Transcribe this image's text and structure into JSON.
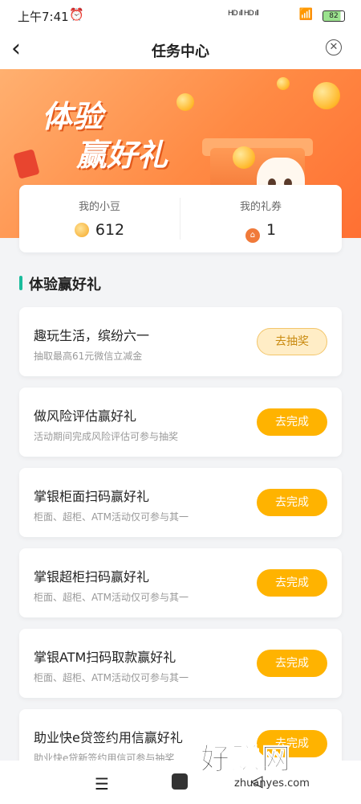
{
  "status_bar": {
    "time": "上午7:41",
    "signal": "HD ıll HD ıll",
    "battery": "82"
  },
  "nav": {
    "title": "任务中心"
  },
  "banner": {
    "line1": "体验",
    "line2": "赢好礼"
  },
  "summary": {
    "beans_label": "我的小豆",
    "beans_value": "612",
    "coupons_label": "我的礼券",
    "coupons_value": "1"
  },
  "section": {
    "title": "体验赢好礼"
  },
  "tasks": [
    {
      "name": "趣玩生活，缤纷六一",
      "desc": "抽取最高61元微信立减金",
      "button": "去抽奖"
    },
    {
      "name": "做风险评估赢好礼",
      "desc": "活动期间完成风险评估可参与抽奖",
      "button": "去完成"
    },
    {
      "name": "掌银柜面扫码赢好礼",
      "desc": "柜面、超柜、ATM活动仅可参与其一",
      "button": "去完成"
    },
    {
      "name": "掌银超柜扫码赢好礼",
      "desc": "柜面、超柜、ATM活动仅可参与其一",
      "button": "去完成"
    },
    {
      "name": "掌银ATM扫码取款赢好礼",
      "desc": "柜面、超柜、ATM活动仅可参与其一",
      "button": "去完成"
    },
    {
      "name": "助业快e贷签约用信赢好礼",
      "desc": "助业快e贷新签约用信可参与抽奖",
      "button": "去完成"
    }
  ],
  "watermark": {
    "text": "好赚网",
    "url": "zhuanyes.com"
  }
}
